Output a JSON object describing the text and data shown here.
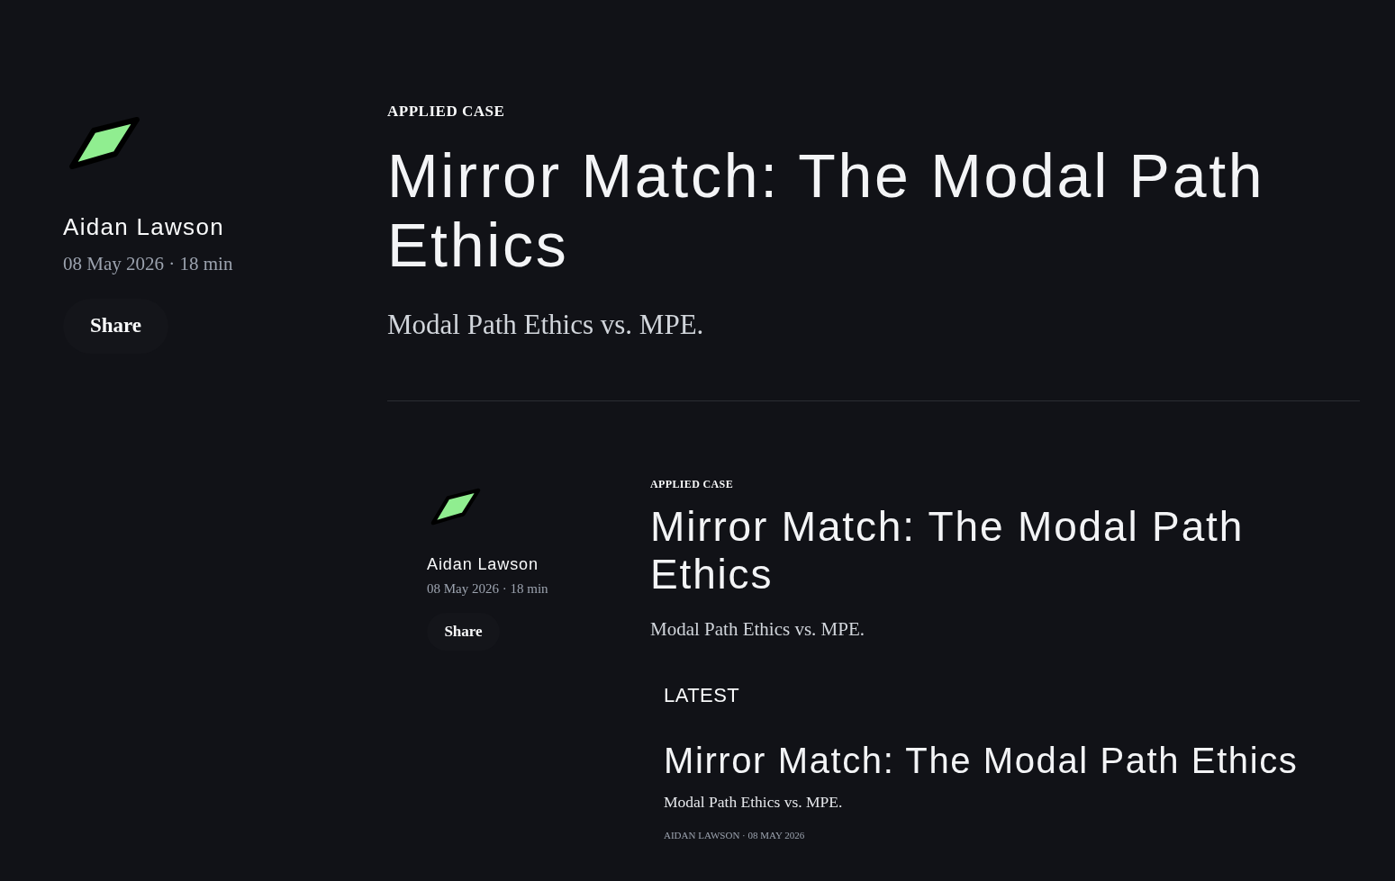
{
  "author": {
    "name": "Aidan Lawson",
    "meta": "08 May 2026 · 18 min",
    "share_label": "Share"
  },
  "article": {
    "category": "APPLIED CASE",
    "title": "Mirror Match: The Modal Path Ethics",
    "subtitle": "Modal Path Ethics vs. MPE."
  },
  "embedded_preview": {
    "author": {
      "name": "Aidan Lawson",
      "meta": "08 May 2026 · 18 min",
      "share_label": "Share"
    },
    "article": {
      "category": "APPLIED CASE",
      "title": "Mirror Match: The Modal Path Ethics",
      "subtitle": "Modal Path Ethics vs. MPE."
    },
    "latest": {
      "heading": "LATEST",
      "title": "Mirror Match: The Modal Path Ethics",
      "subtitle": "Modal Path Ethics vs. MPE.",
      "meta": "AIDAN LAWSON · 08 MAY 2026"
    }
  }
}
